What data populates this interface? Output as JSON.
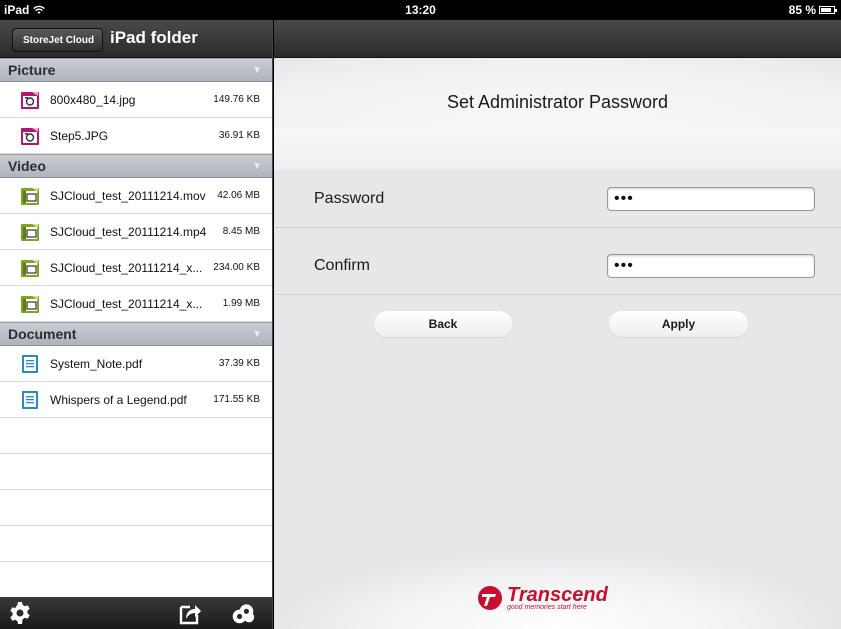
{
  "status_bar": {
    "device": "iPad",
    "time": "13:20",
    "battery": "85 %",
    "battery_level": 0.85
  },
  "left": {
    "back_label": "StoreJet Cloud",
    "title": "iPad folder",
    "sections": [
      {
        "label": "Picture",
        "icon": "picture-file-icon",
        "files": [
          {
            "name": "800x480_14.jpg",
            "size": "149.76 KB"
          },
          {
            "name": "Step5.JPG",
            "size": "36.91 KB"
          }
        ]
      },
      {
        "label": "Video",
        "icon": "video-file-icon",
        "files": [
          {
            "name": "SJCloud_test_20111214.mov",
            "size": "42.06 MB"
          },
          {
            "name": "SJCloud_test_20111214.mp4",
            "size": "8.45 MB"
          },
          {
            "name": "SJCloud_test_20111214_x...",
            "size": "234.00 KB"
          },
          {
            "name": "SJCloud_test_20111214_x...",
            "size": "1.99 MB"
          }
        ]
      },
      {
        "label": "Document",
        "icon": "document-file-icon",
        "files": [
          {
            "name": "System_Note.pdf",
            "size": "37.39 KB"
          },
          {
            "name": "Whispers of a Legend.pdf",
            "size": "171.55 KB"
          }
        ]
      }
    ],
    "toolbar": [
      "settings-gear-icon",
      "share-upload-icon",
      "cloud-icon"
    ]
  },
  "right": {
    "title": "Set Administrator Password",
    "password_label": "Password",
    "password_value": "•••",
    "confirm_label": "Confirm",
    "confirm_value": "•••",
    "back_button": "Back",
    "apply_button": "Apply",
    "brand": {
      "name": "Transcend",
      "tagline": "good memories start here",
      "color": "#c8102e"
    }
  }
}
